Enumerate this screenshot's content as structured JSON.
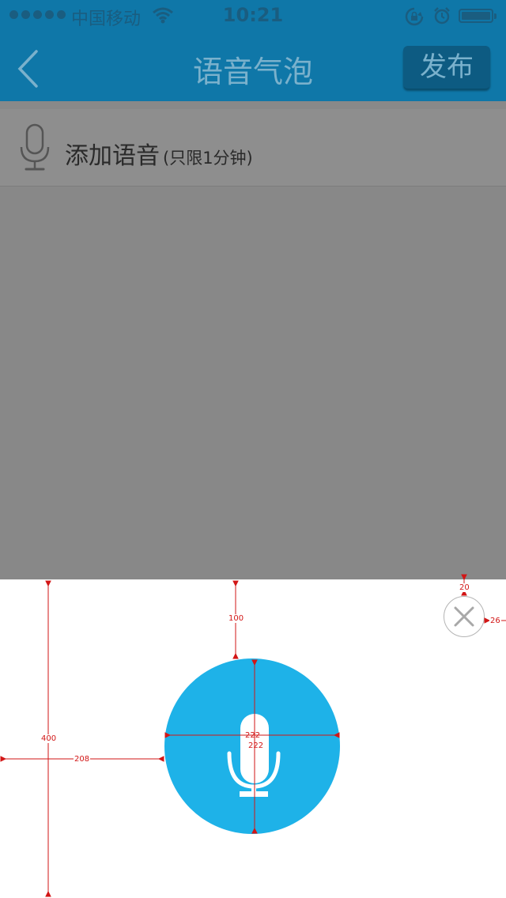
{
  "status_bar": {
    "carrier": "中国移动",
    "time": "10:21",
    "icons": [
      "signal-dots-icon",
      "wifi-icon",
      "rotation-lock-icon",
      "alarm-icon",
      "battery-icon"
    ]
  },
  "nav": {
    "back_icon": "chevron-left-icon",
    "title": "语音气泡",
    "publish_label": "发布"
  },
  "add_voice": {
    "icon": "microphone-icon",
    "label": "添加语音",
    "note": "(只限1分钟)"
  },
  "record_panel": {
    "record_icon": "microphone-icon",
    "close_icon": "close-icon",
    "colors": {
      "record_button": "#1eb2e8",
      "nav": "#0f77a8",
      "annotation": "#d21616"
    }
  },
  "annotations": {
    "panel_height": "400",
    "gap_top": "100",
    "button_left": "208",
    "button_width": "222",
    "button_height": "222",
    "close_top": "20",
    "close_right": "26"
  }
}
